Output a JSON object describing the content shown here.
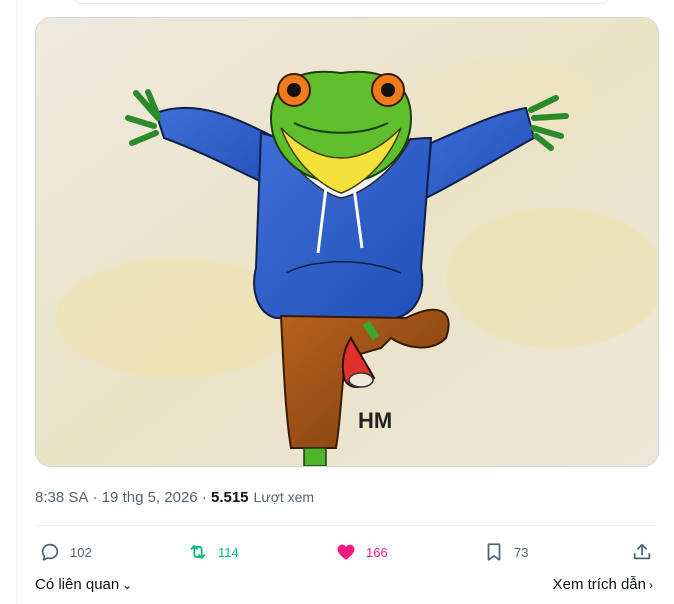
{
  "tweet": {
    "image": {
      "alt": "",
      "signature_text": "HM"
    },
    "meta": {
      "time": "8:38 SA",
      "separator": " · ",
      "date": "19 thg 5, 2026",
      "views_count": "5.515",
      "views_label": "Lượt xem"
    },
    "actions": {
      "replies": "102",
      "retweets": "114",
      "likes": "166",
      "bookmarks": "73"
    },
    "footer": {
      "related_label": "Có liên quan",
      "quotes_label": "Xem trích dẫn"
    }
  },
  "colors": {
    "retweet_active": "#00ba7c",
    "like_active": "#f91880",
    "secondary_text": "#536471"
  },
  "icons": [
    "reply-icon",
    "retweet-icon",
    "like-icon",
    "bookmark-icon",
    "share-icon",
    "chevron-down-icon",
    "chevron-right-icon"
  ]
}
